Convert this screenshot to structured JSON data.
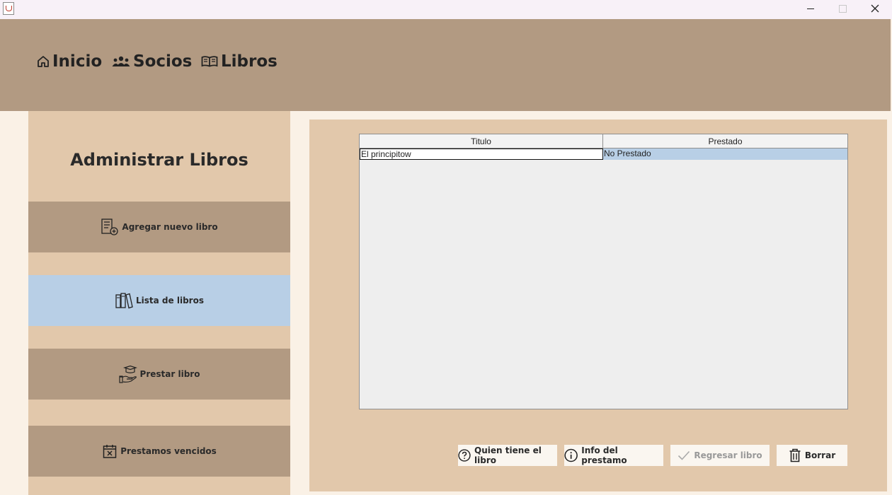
{
  "window": {
    "minimize": "—",
    "maximize": "☐",
    "close": "✕"
  },
  "nav": {
    "inicio": "Inicio",
    "socios": "Socios",
    "libros": "Libros"
  },
  "sidebar": {
    "title": "Administrar Libros",
    "items": [
      {
        "label": "Agregar nuevo libro",
        "icon": "add-book-icon"
      },
      {
        "label": "Lista de libros",
        "icon": "books-icon",
        "active": true
      },
      {
        "label": "Prestar libro",
        "icon": "lend-hand-icon"
      },
      {
        "label": "Prestamos vencidos",
        "icon": "calendar-x-icon"
      }
    ]
  },
  "table": {
    "columns": [
      "Titulo",
      "Prestado"
    ],
    "rows": [
      [
        "El principitow",
        "No Prestado"
      ]
    ]
  },
  "actions": {
    "quien": "Quien tiene el libro",
    "info": "Info del prestamo",
    "regresar": "Regresar libro",
    "borrar": "Borrar"
  },
  "colors": {
    "header": "#b29a82",
    "sidebar": "#e2c8ab",
    "active": "#b8cfe6",
    "background": "#faf1e6"
  }
}
